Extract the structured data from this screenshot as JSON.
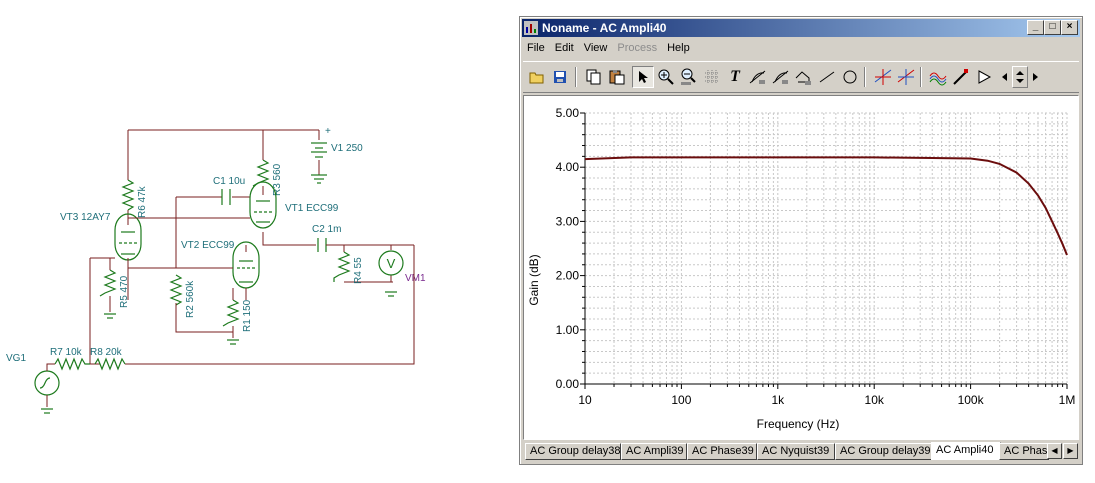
{
  "schematic": {
    "labels": {
      "v1": "V1 250",
      "v1_plus": "+",
      "c1": "C1 10u",
      "r3": "R3 560",
      "vt1": "VT1 ECC99",
      "vt3": "VT3 12AY7",
      "r6": "R6 47k",
      "vt2": "VT2 ECC99",
      "c2": "C2 1m",
      "r4": "R4 55",
      "vm1": "VM1",
      "vm_symbol": "V",
      "r5": "R5 470",
      "r2": "R2 560k",
      "r1": "R1 150",
      "vg1": "VG1",
      "r7": "R7 10k",
      "r8": "R8 20k"
    }
  },
  "window": {
    "title": "Noname - AC Ampli40",
    "controls": {
      "minimize": "_",
      "maximize": "□",
      "close": "×"
    },
    "menu": [
      {
        "label": "File",
        "disabled": false
      },
      {
        "label": "Edit",
        "disabled": false
      },
      {
        "label": "View",
        "disabled": false
      },
      {
        "label": "Process",
        "disabled": true
      },
      {
        "label": "Help",
        "disabled": false
      }
    ],
    "toolbar": [
      "open-icon",
      "save-icon",
      "copy-icon",
      "paste-icon",
      "pointer-icon",
      "zoom-in-icon",
      "zoom-100-icon",
      "grid-icon",
      "text-icon",
      "tangent-icon",
      "tangent-2-icon",
      "polyline-icon",
      "line-icon",
      "circle-icon",
      "cursor-a-icon",
      "cursor-b-icon",
      "curves-icon",
      "pen-icon",
      "arrow-icon",
      "scroll-left-icon",
      "scroll-updown-icon",
      "scroll-right-icon"
    ],
    "toolbar_text_glyph": "T",
    "tabs": [
      "AC Group delay38",
      "AC Ampli39",
      "AC Phase39",
      "AC Nyquist39",
      "AC Group delay39",
      "AC Ampli40",
      "AC Phas"
    ],
    "active_tab": "AC Ampli40",
    "tab_scroll": {
      "left": "◀",
      "right": "▶"
    }
  },
  "colors": {
    "curve": "#6b0d0d",
    "title_start": "#0a246a",
    "title_end": "#a6caf0"
  },
  "chart_data": {
    "type": "line",
    "xlabel": "Frequency (Hz)",
    "ylabel": "Gain (dB)",
    "xscale": "log",
    "xlim": [
      10,
      1000000
    ],
    "ylim": [
      0,
      5
    ],
    "xticks": [
      "10",
      "100",
      "1k",
      "10k",
      "100k",
      "1M"
    ],
    "yticks": [
      "0.00",
      "1.00",
      "2.00",
      "3.00",
      "4.00",
      "5.00"
    ],
    "grid": true,
    "series": [
      {
        "x": [
          10,
          30,
          100,
          1000,
          10000,
          40000,
          100000,
          150000,
          200000,
          300000,
          400000,
          500000,
          600000,
          700000,
          800000,
          900000,
          1000000
        ],
        "y": [
          4.15,
          4.18,
          4.18,
          4.18,
          4.18,
          4.17,
          4.16,
          4.12,
          4.06,
          3.9,
          3.7,
          3.48,
          3.25,
          3.0,
          2.78,
          2.58,
          2.38
        ]
      }
    ]
  }
}
